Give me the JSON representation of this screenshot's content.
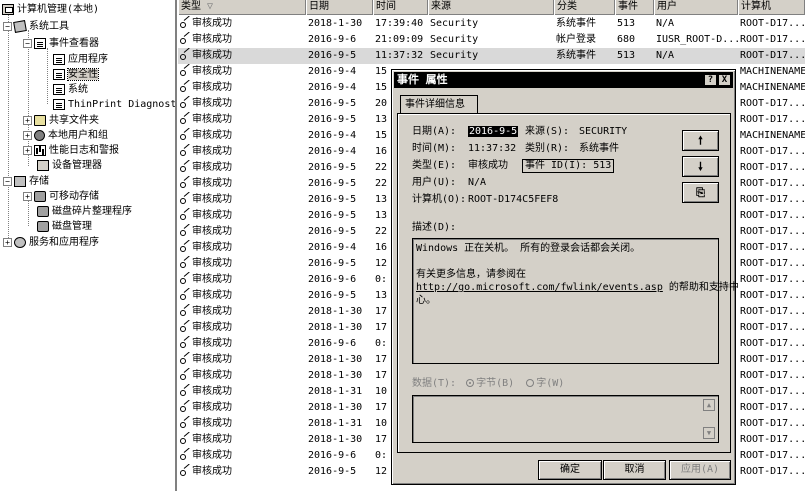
{
  "tree": {
    "root": "计算机管理(本地)",
    "system_tools": "系统工具",
    "event_viewer": "事件查看器",
    "application": "应用程序",
    "security": "安全性",
    "system": "系统",
    "thinprint": "ThinPrint Diagnosti",
    "shared_folders": "共享文件夹",
    "local_users": "本地用户和组",
    "perf_logs": "性能日志和警报",
    "device_manager": "设备管理器",
    "storage": "存储",
    "removable_storage": "可移动存储",
    "defrag": "磁盘碎片整理程序",
    "disk_mgmt": "磁盘管理",
    "services_apps": "服务和应用程序",
    "expand_minus": "−",
    "expand_plus": "+"
  },
  "list": {
    "columns": [
      "类型",
      "日期",
      "时间",
      "来源",
      "分类",
      "事件",
      "用户",
      "计算机"
    ],
    "sort_indicator": "▽",
    "rows": [
      [
        "审核成功",
        "2018-1-30",
        "17:39:40",
        "Security",
        "系统事件",
        "513",
        "N/A",
        "ROOT-D17..."
      ],
      [
        "审核成功",
        "2016-9-6",
        "21:09:09",
        "Security",
        "帐户登录",
        "680",
        "IUSR_ROOT-D...",
        "ROOT-D17..."
      ],
      [
        "审核成功",
        "2016-9-5",
        "11:37:32",
        "Security",
        "系统事件",
        "513",
        "N/A",
        "ROOT-D17..."
      ],
      [
        "审核成功",
        "2016-9-4",
        "15",
        "",
        "",
        "",
        "",
        "MACHINENAME"
      ],
      [
        "审核成功",
        "2016-9-4",
        "15",
        "",
        "",
        "",
        "",
        "MACHINENAME"
      ],
      [
        "审核成功",
        "2016-9-5",
        "20",
        "",
        "",
        "",
        "",
        "ROOT-D17..."
      ],
      [
        "审核成功",
        "2016-9-5",
        "13",
        "",
        "",
        "",
        "",
        "ROOT-D17..."
      ],
      [
        "审核成功",
        "2016-9-4",
        "15",
        "",
        "",
        "",
        "",
        "MACHINENAME"
      ],
      [
        "审核成功",
        "2016-9-4",
        "16",
        "",
        "",
        "",
        "",
        "ROOT-D17..."
      ],
      [
        "审核成功",
        "2016-9-5",
        "22",
        "",
        "",
        "",
        "",
        "ROOT-D17..."
      ],
      [
        "审核成功",
        "2016-9-5",
        "22",
        "",
        "",
        "",
        "",
        "ROOT-D17..."
      ],
      [
        "审核成功",
        "2016-9-5",
        "13",
        "",
        "",
        "",
        "",
        "ROOT-D17..."
      ],
      [
        "审核成功",
        "2016-9-5",
        "13",
        "",
        "",
        "",
        "",
        "ROOT-D17..."
      ],
      [
        "审核成功",
        "2016-9-5",
        "22",
        "",
        "",
        "",
        "",
        "ROOT-D17..."
      ],
      [
        "审核成功",
        "2016-9-4",
        "16",
        "",
        "",
        "",
        "",
        "ROOT-D17..."
      ],
      [
        "审核成功",
        "2016-9-5",
        "12",
        "",
        "",
        "",
        "",
        "ROOT-D17..."
      ],
      [
        "审核成功",
        "2016-9-6",
        "0:",
        "",
        "",
        "",
        "",
        "ROOT-D17..."
      ],
      [
        "审核成功",
        "2016-9-5",
        "13",
        "",
        "",
        "",
        "",
        "ROOT-D17..."
      ],
      [
        "审核成功",
        "2018-1-30",
        "17",
        "",
        "",
        "",
        "",
        "ROOT-D17..."
      ],
      [
        "审核成功",
        "2018-1-30",
        "17",
        "",
        "",
        "",
        "",
        "ROOT-D17..."
      ],
      [
        "审核成功",
        "2016-9-6",
        "0:",
        "",
        "",
        "",
        "",
        "ROOT-D17..."
      ],
      [
        "审核成功",
        "2018-1-30",
        "17",
        "",
        "",
        "",
        "",
        "ROOT-D17..."
      ],
      [
        "审核成功",
        "2018-1-30",
        "17",
        "",
        "",
        "",
        "",
        "ROOT-D17..."
      ],
      [
        "审核成功",
        "2018-1-31",
        "10",
        "",
        "",
        "",
        "",
        "ROOT-D17..."
      ],
      [
        "审核成功",
        "2018-1-30",
        "17",
        "",
        "",
        "",
        "",
        "ROOT-D17..."
      ],
      [
        "审核成功",
        "2018-1-31",
        "10",
        "",
        "",
        "",
        "",
        "ROOT-D17..."
      ],
      [
        "审核成功",
        "2018-1-30",
        "17",
        "",
        "",
        "",
        "",
        "ROOT-D17..."
      ],
      [
        "审核成功",
        "2016-9-6",
        "0:",
        "",
        "",
        "",
        "",
        "ROOT-D17..."
      ],
      [
        "审核成功",
        "2016-9-5",
        "12",
        "",
        "",
        "",
        "",
        "ROOT-D17..."
      ]
    ],
    "selected_row": 2
  },
  "dialog": {
    "title": "事件 属性",
    "help_btn": "?",
    "close_btn": "X",
    "tab_label": "事件详细信息",
    "date_label": "日期(A):",
    "date_value": "2016-9-5",
    "source_label": "来源(S):",
    "source_value": "SECURITY",
    "time_label": "时间(M):",
    "time_value": "11:37:32",
    "category_label": "类别(R):",
    "category_value": "系统事件",
    "type_label": "类型(E):",
    "type_value": "审核成功",
    "event_id_label": "事件 ID(I):",
    "event_id_value": "513",
    "user_label": "用户(U):",
    "user_value": "N/A",
    "computer_label": "计算机(O):",
    "computer_value": "ROOT-D174C5FEF8",
    "up_arrow": "🠕",
    "down_arrow": "🠗",
    "copy_icon": "⎘",
    "desc_label": "描述(D):",
    "desc_line1": "Windows 正在关机。 所有的登录会话都会关闭。",
    "desc_line2": "有关更多信息，请参阅在",
    "desc_link": "http://go.microsoft.com/fwlink/events.asp",
    "desc_line3": " 的帮助和支持中",
    "desc_line4": "心。",
    "data_label": "数据(T):",
    "bytes_label": "字节(B)",
    "words_label": "字(W)",
    "ok_btn": "确定",
    "cancel_btn": "取消",
    "apply_btn": "应用(A)"
  },
  "colors": {
    "window_face": "#d4d0c8",
    "title_bar": "#000000",
    "selection": "#d9d9d9"
  }
}
